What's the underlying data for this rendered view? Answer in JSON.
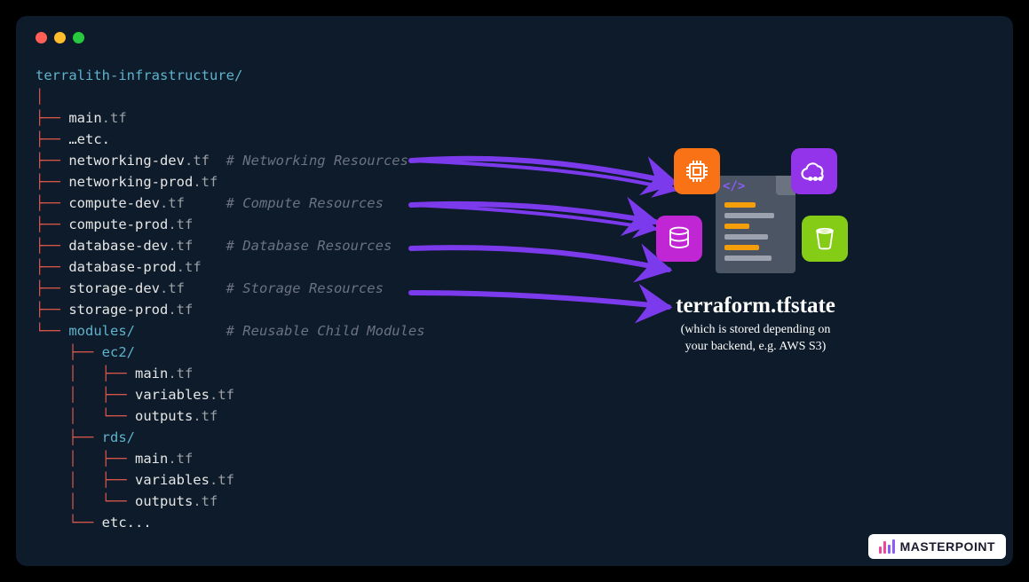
{
  "tree": {
    "root": "terralith-infrastructure/",
    "files": [
      {
        "branch": "├── ",
        "name": "main",
        "ext": ".tf",
        "comment": ""
      },
      {
        "branch": "├── ",
        "name": "…etc.",
        "ext": "",
        "comment": ""
      },
      {
        "branch": "├── ",
        "name": "networking-dev",
        "ext": ".tf",
        "comment": "  # Networking Resources"
      },
      {
        "branch": "├── ",
        "name": "networking-prod",
        "ext": ".tf",
        "comment": ""
      },
      {
        "branch": "├── ",
        "name": "compute-dev",
        "ext": ".tf",
        "comment": "     # Compute Resources"
      },
      {
        "branch": "├── ",
        "name": "compute-prod",
        "ext": ".tf",
        "comment": ""
      },
      {
        "branch": "├── ",
        "name": "database-dev",
        "ext": ".tf",
        "comment": "    # Database Resources"
      },
      {
        "branch": "├── ",
        "name": "database-prod",
        "ext": ".tf",
        "comment": ""
      },
      {
        "branch": "├── ",
        "name": "storage-dev",
        "ext": ".tf",
        "comment": "     # Storage Resources"
      },
      {
        "branch": "├── ",
        "name": "storage-prod",
        "ext": ".tf",
        "comment": ""
      }
    ],
    "modules_label": "modules/",
    "modules_branch": "└── ",
    "modules_comment": "           # Reusable Child Modules",
    "modules": [
      {
        "branch": "    ├── ",
        "name": "ec2/",
        "isdir": true
      },
      {
        "branch": "    │   ├── ",
        "name": "main",
        "ext": ".tf"
      },
      {
        "branch": "    │   ├── ",
        "name": "variables",
        "ext": ".tf"
      },
      {
        "branch": "    │   └── ",
        "name": "outputs",
        "ext": ".tf"
      },
      {
        "branch": "    ├── ",
        "name": "rds/",
        "isdir": true
      },
      {
        "branch": "    │   ├── ",
        "name": "main",
        "ext": ".tf"
      },
      {
        "branch": "    │   ├── ",
        "name": "variables",
        "ext": ".tf"
      },
      {
        "branch": "    │   └── ",
        "name": "outputs",
        "ext": ".tf"
      },
      {
        "branch": "    └── ",
        "name": "etc...",
        "ext": ""
      }
    ],
    "pipe": "│"
  },
  "state": {
    "title": "terraform.tfstate",
    "subtitle": "(which is stored depending on\nyour backend, e.g. AWS S3)"
  },
  "icons": {
    "chip": {
      "color": "#f97316",
      "name": "chip-icon"
    },
    "cloud": {
      "color": "#9333ea",
      "name": "cloud-icon"
    },
    "database": {
      "color": "#c026d3",
      "name": "database-icon"
    },
    "bucket": {
      "color": "#84cc16",
      "name": "bucket-icon"
    }
  },
  "logo": {
    "text": "MASTERPOINT"
  },
  "colors": {
    "arrow": "#7c3aed"
  }
}
